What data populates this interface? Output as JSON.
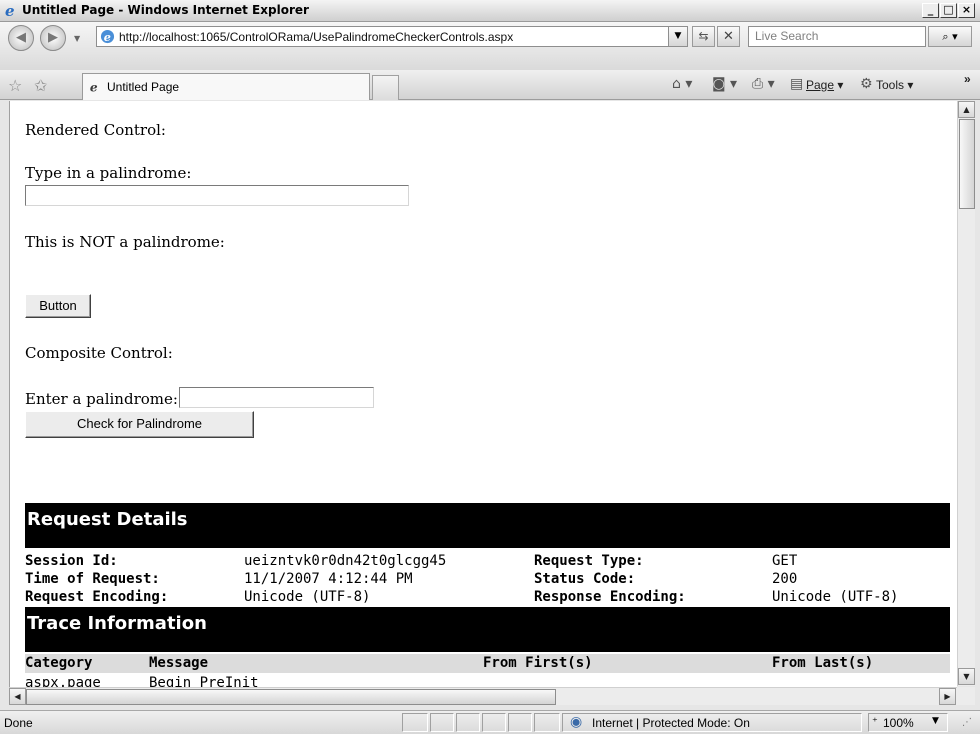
{
  "window": {
    "title": "Untitled Page - Windows Internet Explorer",
    "minimize_glyph": "_",
    "maximize_glyph": "□",
    "close_glyph": "×"
  },
  "address_bar": {
    "url": "http://localhost:1065/ControlORama/UsePalindromeCheckerControls.aspx",
    "search_placeholder": "Live Search"
  },
  "tabs": [
    {
      "label": "Untitled Page",
      "active": true
    }
  ],
  "command_bar": {
    "page_label": "Page",
    "tools_label": "Tools",
    "overflow_glyph": "»"
  },
  "page": {
    "rendered_control_label": "Rendered Control:",
    "type_palindrome_label": "Type in a palindrome:",
    "type_palindrome_value": "",
    "result_text": "This is NOT a palindrome:",
    "button_label": "Button",
    "composite_control_label": "Composite Control:",
    "enter_palindrome_label": "Enter a palindrome:",
    "enter_palindrome_value": "",
    "check_button_label": "Check for Palindrome"
  },
  "trace": {
    "request_details_title": "Request Details",
    "session_id_label": "Session Id:",
    "session_id_value": "ueizntvk0r0dn42t0glcgg45",
    "request_type_label": "Request Type:",
    "request_type_value": "GET",
    "time_of_request_label": "Time of Request:",
    "time_of_request_value": "11/1/2007 4:12:44 PM",
    "status_code_label": "Status Code:",
    "status_code_value": "200",
    "request_encoding_label": "Request Encoding:",
    "request_encoding_value": "Unicode (UTF-8)",
    "response_encoding_label": "Response Encoding:",
    "response_encoding_value": "Unicode (UTF-8)",
    "trace_information_title": "Trace Information",
    "columns": [
      "Category",
      "Message",
      "From First(s)",
      "From Last(s)"
    ],
    "rows": [
      {
        "category": "aspx.page",
        "message": "Begin PreInit"
      }
    ]
  },
  "status_bar": {
    "status_text": "Done",
    "zone_text": "Internet | Protected Mode: On",
    "zoom_text": "100%"
  },
  "colors": {
    "trace_header_bg": "#000000",
    "trace_header_fg": "#ffffff",
    "column_header_bg": "#dcdcdc"
  }
}
